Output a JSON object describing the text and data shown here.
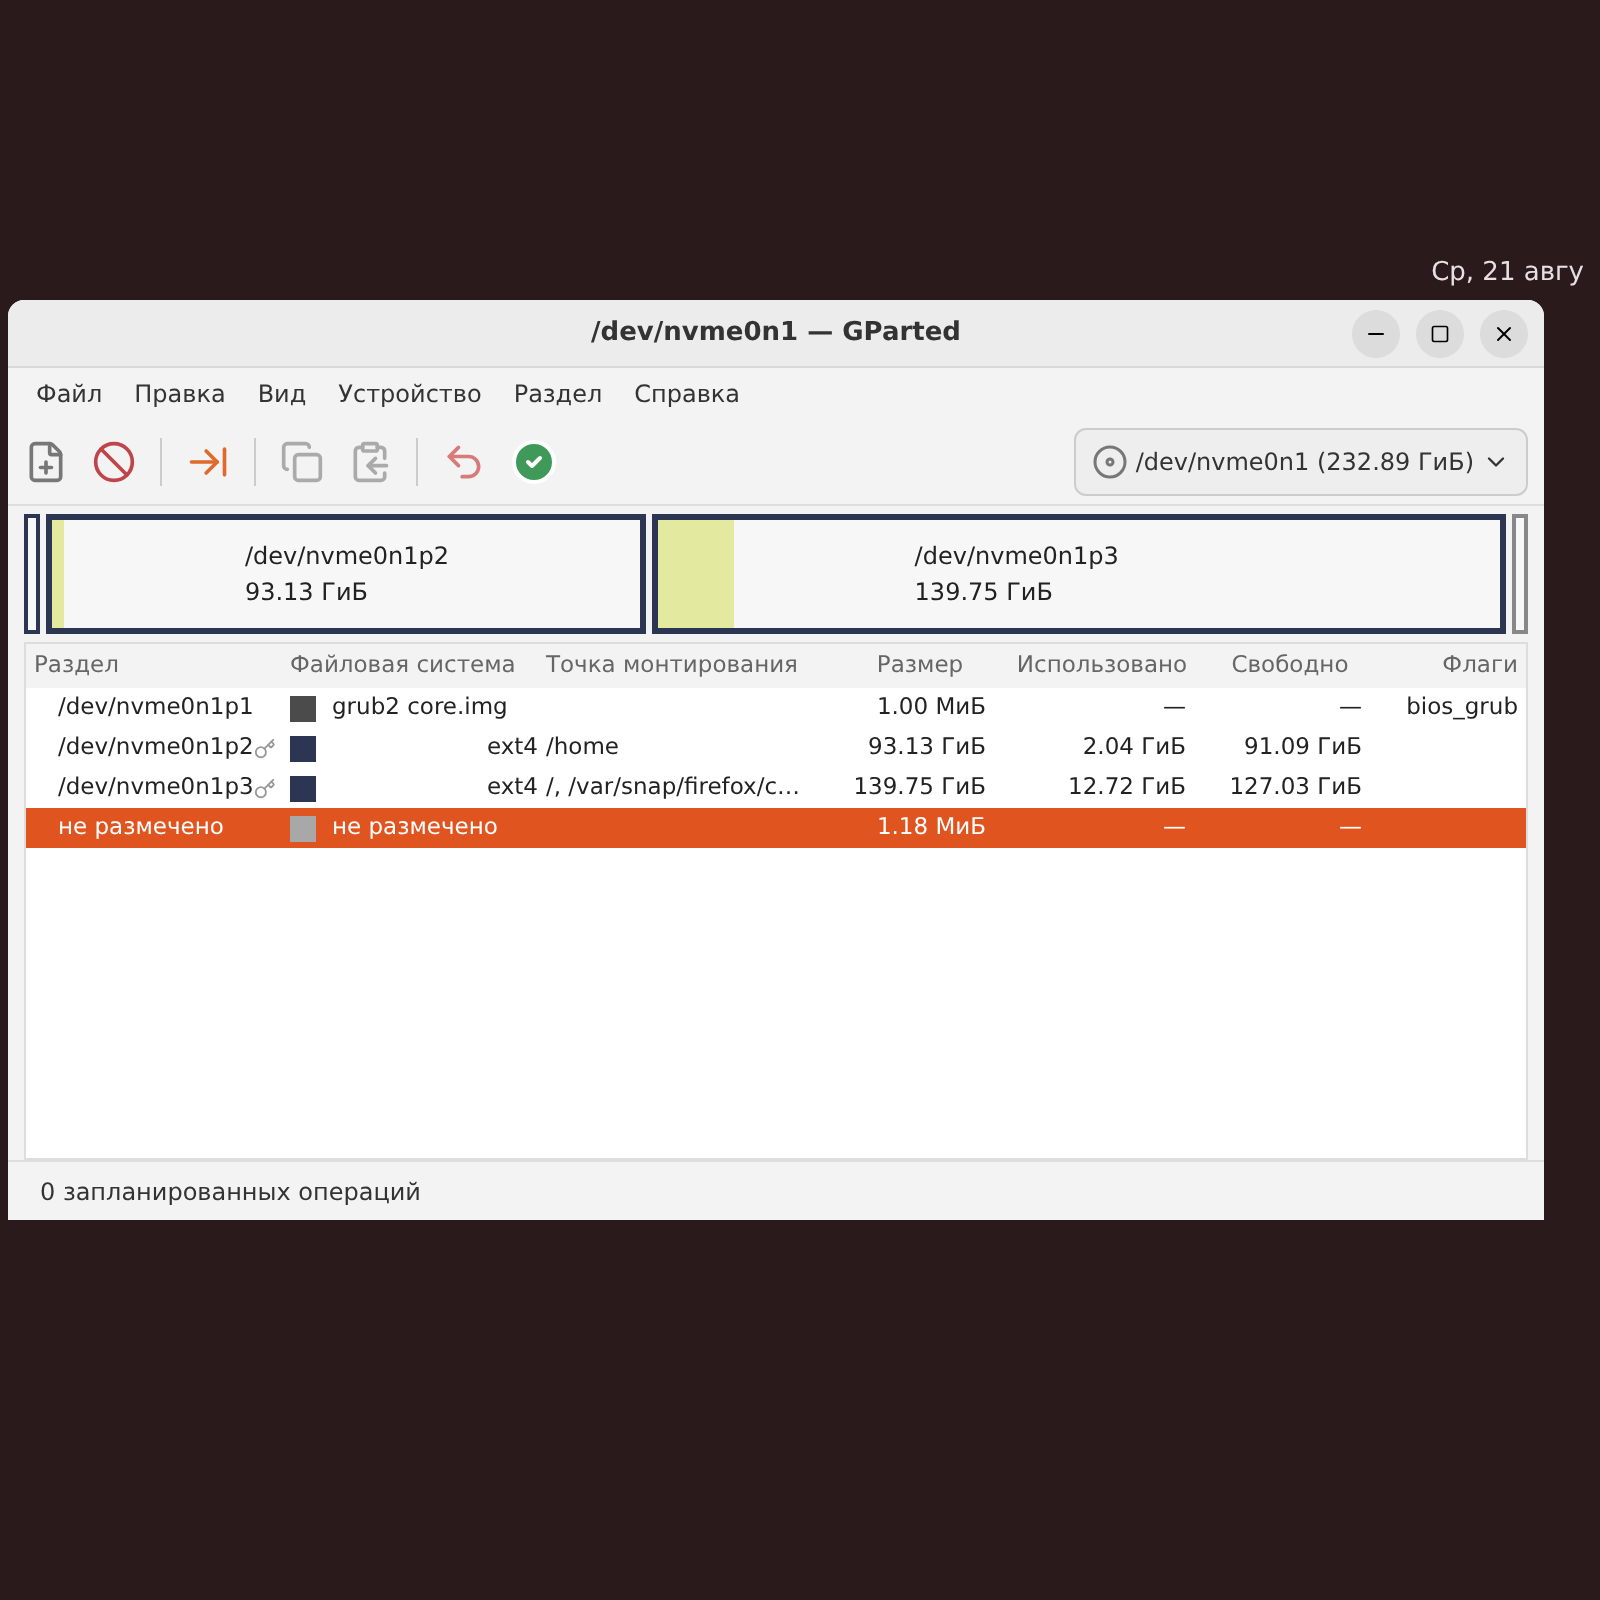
{
  "top_bar": {
    "clock": "Ср, 21 авгу"
  },
  "window": {
    "title": "/dev/nvme0n1 — GParted"
  },
  "menu": [
    "Файл",
    "Правка",
    "Вид",
    "Устройство",
    "Раздел",
    "Справка"
  ],
  "device_selector": {
    "value": "/dev/nvme0n1 (232.89 ГиБ)"
  },
  "partition_map": [
    {
      "kind": "small"
    },
    {
      "kind": "partition",
      "name": "/dev/nvme0n1p2",
      "size": "93.13 ГиБ",
      "level": 0.022
    },
    {
      "kind": "partition",
      "name": "/dev/nvme0n1p3",
      "size": "139.75 ГиБ",
      "level": 0.091
    },
    {
      "kind": "unallocated"
    }
  ],
  "table": {
    "columns": [
      "Раздел",
      "Файловая система",
      "Точка монтирования",
      "Размер",
      "Использовано",
      "Свободно",
      "Флаги"
    ],
    "rows": [
      {
        "partition": "/dev/nvme0n1p1",
        "locked": false,
        "color": "#4b4b4b",
        "filesystem": "grub2 core.img",
        "mount": "",
        "size": "1.00 МиБ",
        "used": "—",
        "free": "—",
        "flags": "bios_grub",
        "selected": false
      },
      {
        "partition": "/dev/nvme0n1p2",
        "locked": true,
        "color": "#2c3552",
        "filesystem": "ext4",
        "mount": "/home",
        "size": "93.13 ГиБ",
        "used": "2.04 ГиБ",
        "free": "91.09 ГиБ",
        "flags": "",
        "selected": false
      },
      {
        "partition": "/dev/nvme0n1p3",
        "locked": true,
        "color": "#2c3552",
        "filesystem": "ext4",
        "mount": "/, /var/snap/firefox/c…",
        "size": "139.75 ГиБ",
        "used": "12.72 ГиБ",
        "free": "127.03 ГиБ",
        "flags": "",
        "selected": false
      },
      {
        "partition": "не размечено",
        "locked": false,
        "color": "#a8a8a8",
        "filesystem": "не размечено",
        "mount": "",
        "size": "1.18 МиБ",
        "used": "—",
        "free": "—",
        "flags": "",
        "selected": true
      }
    ]
  },
  "status_bar": "0 запланированных операций"
}
